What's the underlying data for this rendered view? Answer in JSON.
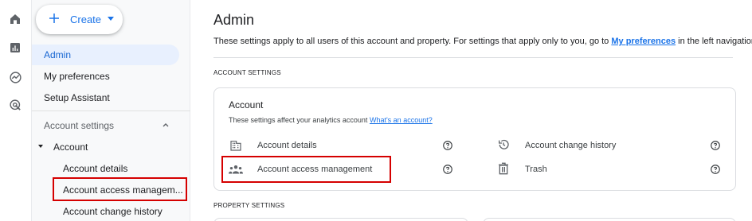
{
  "rail": {
    "icons": [
      "home-icon",
      "reports-icon",
      "explore-icon",
      "advertising-icon"
    ]
  },
  "sidebar": {
    "create_label": "Create",
    "items": [
      {
        "label": "Admin"
      },
      {
        "label": "My preferences"
      },
      {
        "label": "Setup Assistant"
      }
    ],
    "section": {
      "label": "Account settings",
      "group": "Account",
      "sub_items": [
        {
          "label": "Account details"
        },
        {
          "label": "Account access managem..."
        },
        {
          "label": "Account change history"
        }
      ]
    }
  },
  "main": {
    "title": "Admin",
    "description_prefix": "These settings apply to all users of this account and property. For settings that apply only to you, go to",
    "description_link": "My preferences",
    "description_suffix": "in the left navigation.",
    "account_settings_caption": "ACCOUNT SETTINGS",
    "property_settings_caption": "PROPERTY SETTINGS",
    "card": {
      "title": "Account",
      "description": "These settings affect your analytics account",
      "description_link": "What's an account?",
      "rows": [
        {
          "label": "Account details",
          "icon": "building-icon"
        },
        {
          "label": "Account change history",
          "icon": "history-icon"
        },
        {
          "label": "Account access management",
          "icon": "people-icon"
        },
        {
          "label": "Trash",
          "icon": "trash-icon"
        }
      ]
    }
  },
  "colors": {
    "accent": "#1a73e8",
    "active_bg": "#e8f0fe",
    "highlight": "#d50000"
  }
}
